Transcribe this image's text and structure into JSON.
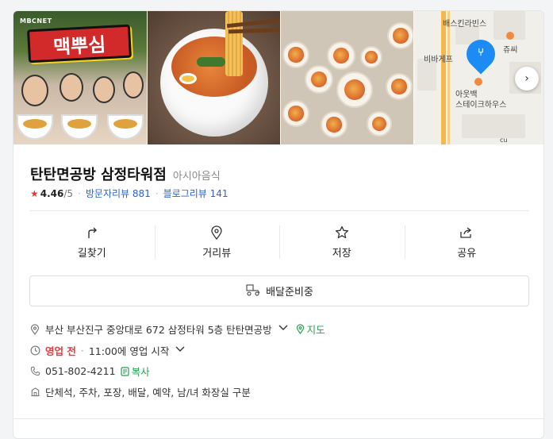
{
  "photos": {
    "photo1_logo": "MBCNET",
    "photo1_title": "맥뿌심"
  },
  "map": {
    "labels": [
      "배스킨라빈스",
      "쥬씨",
      "비바게프",
      "아웃백",
      "스테이크하우스",
      "cu"
    ]
  },
  "place": {
    "name": "탄탄면공방 삼정타워점",
    "category": "아시아음식",
    "rating": "4.46",
    "rating_max": "/5",
    "visitor_review": "방문자리뷰 881",
    "blog_review": "블로그리뷰 141"
  },
  "actions": {
    "directions": "길찾기",
    "street_view": "거리뷰",
    "save": "저장",
    "share": "공유"
  },
  "delivery_label": "배달준비중",
  "info": {
    "address": "부산 부산진구 중앙대로 672 삼정타워 5층 탄탄면공방",
    "map_link": "지도",
    "status": "영업 전",
    "hours": "11:00에 영업 시작",
    "phone": "051-802-4211",
    "copy": "복사",
    "facilities": "단체석, 주차, 포장, 배달, 예약, 남/녀 화장실 구분"
  },
  "colors": {
    "accent_blue": "#2d62c9",
    "star_red": "#e43a3a",
    "green": "#21a44d"
  }
}
